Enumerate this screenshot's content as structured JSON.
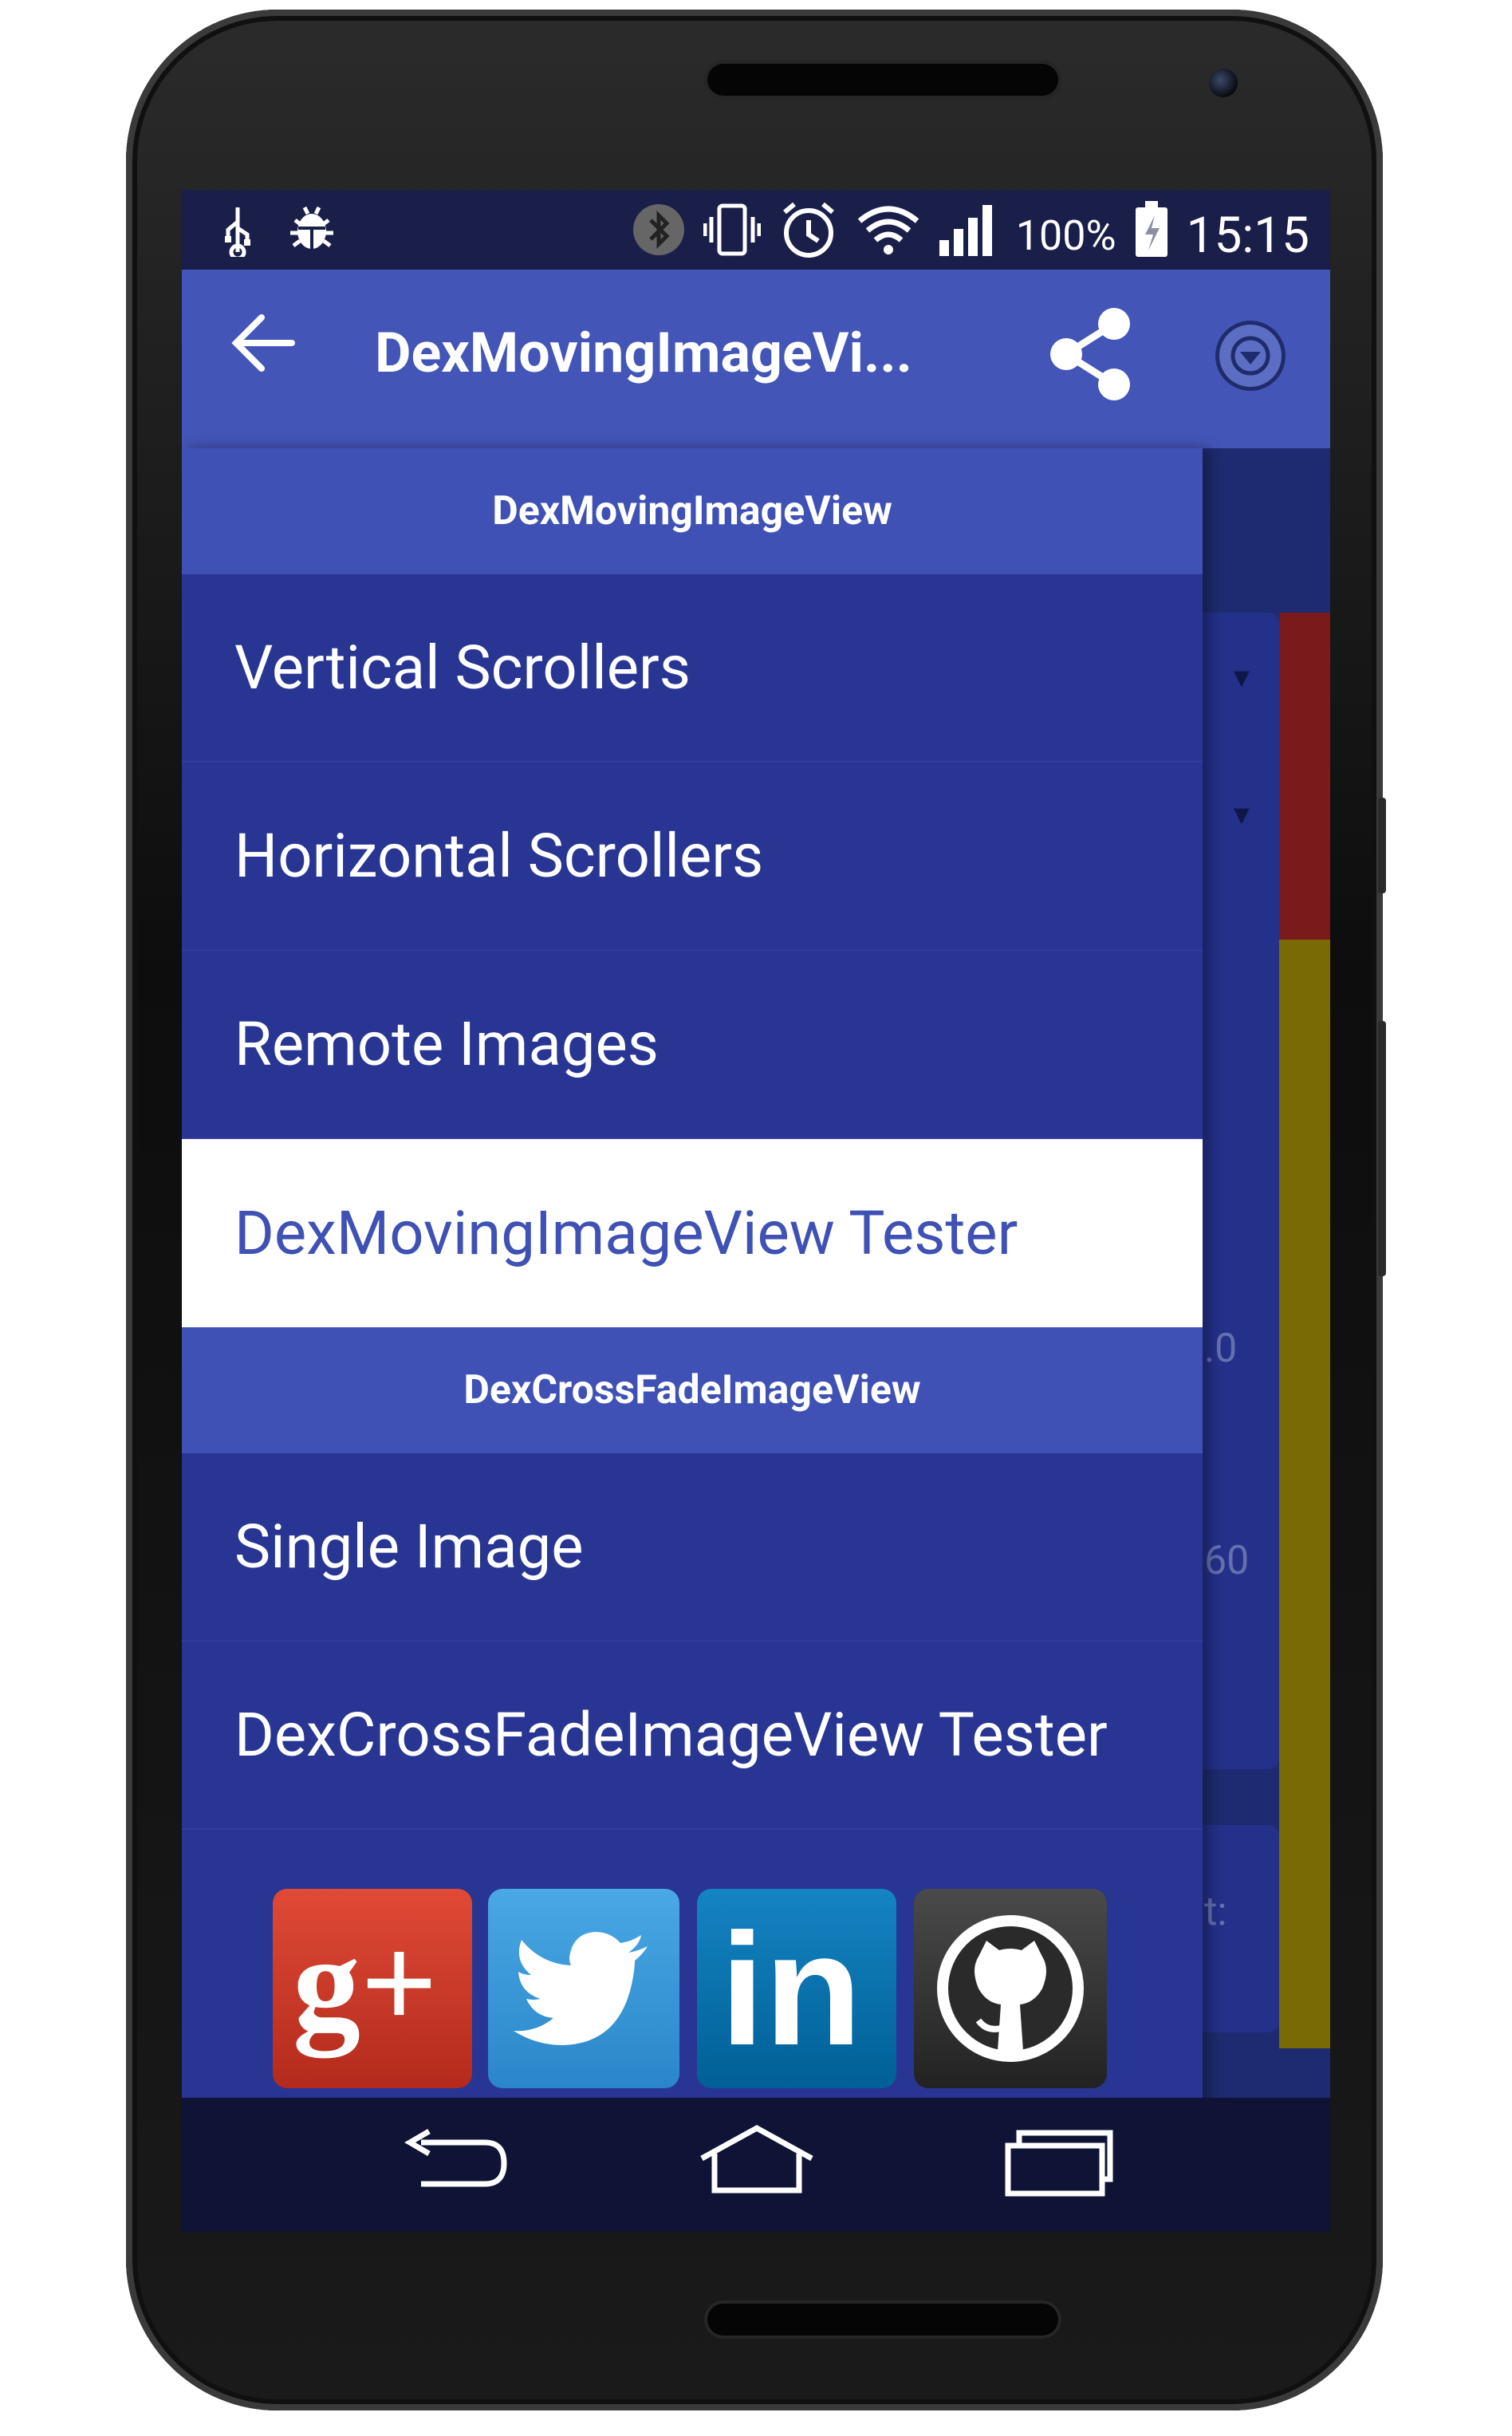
{
  "status_bar": {
    "left_icons": [
      "usb-icon",
      "bug-icon"
    ],
    "right_icons": [
      "bluetooth-icon",
      "vibrate-icon",
      "alarm-icon",
      "wifi-icon",
      "signal-icon",
      "battery-icon"
    ],
    "battery": "100%",
    "time": "15:15"
  },
  "app_bar": {
    "title": "DexMovingImageVi...",
    "back_icon": "back-arrow-icon",
    "share_icon": "share-icon",
    "menu_icon": "dropdown-circle-icon"
  },
  "drawer": {
    "sections": [
      {
        "header": "DexMovingImageView",
        "items": [
          "Vertical Scrollers",
          "Horizontal Scrollers",
          "Remote Images",
          "DexMovingImageView Tester"
        ]
      },
      {
        "header": "DexCrossFadeImageView",
        "items": [
          "Single Image",
          "DexCrossFadeImageView Tester"
        ]
      }
    ],
    "selected_item": "DexMovingImageView Tester",
    "social": [
      {
        "name": "google-plus",
        "label": "g+",
        "color": "#d13b2b"
      },
      {
        "name": "twitter",
        "label": "",
        "color": "#3b9ee0"
      },
      {
        "name": "linkedin",
        "label": "in",
        "color": "#0a77b5"
      },
      {
        "name": "github",
        "label": "",
        "color": "#3a3a3a"
      }
    ]
  },
  "background": {
    "partial_texts": [
      ".0",
      "60",
      "t:"
    ]
  },
  "nav_bar": {
    "icons": [
      "back-icon",
      "home-icon",
      "recents-icon"
    ]
  },
  "colors": {
    "primary": "#3f51b5",
    "primary_dark": "#283593",
    "accent_red": "#7a1a1a",
    "accent_yellow": "#7a6a05"
  }
}
